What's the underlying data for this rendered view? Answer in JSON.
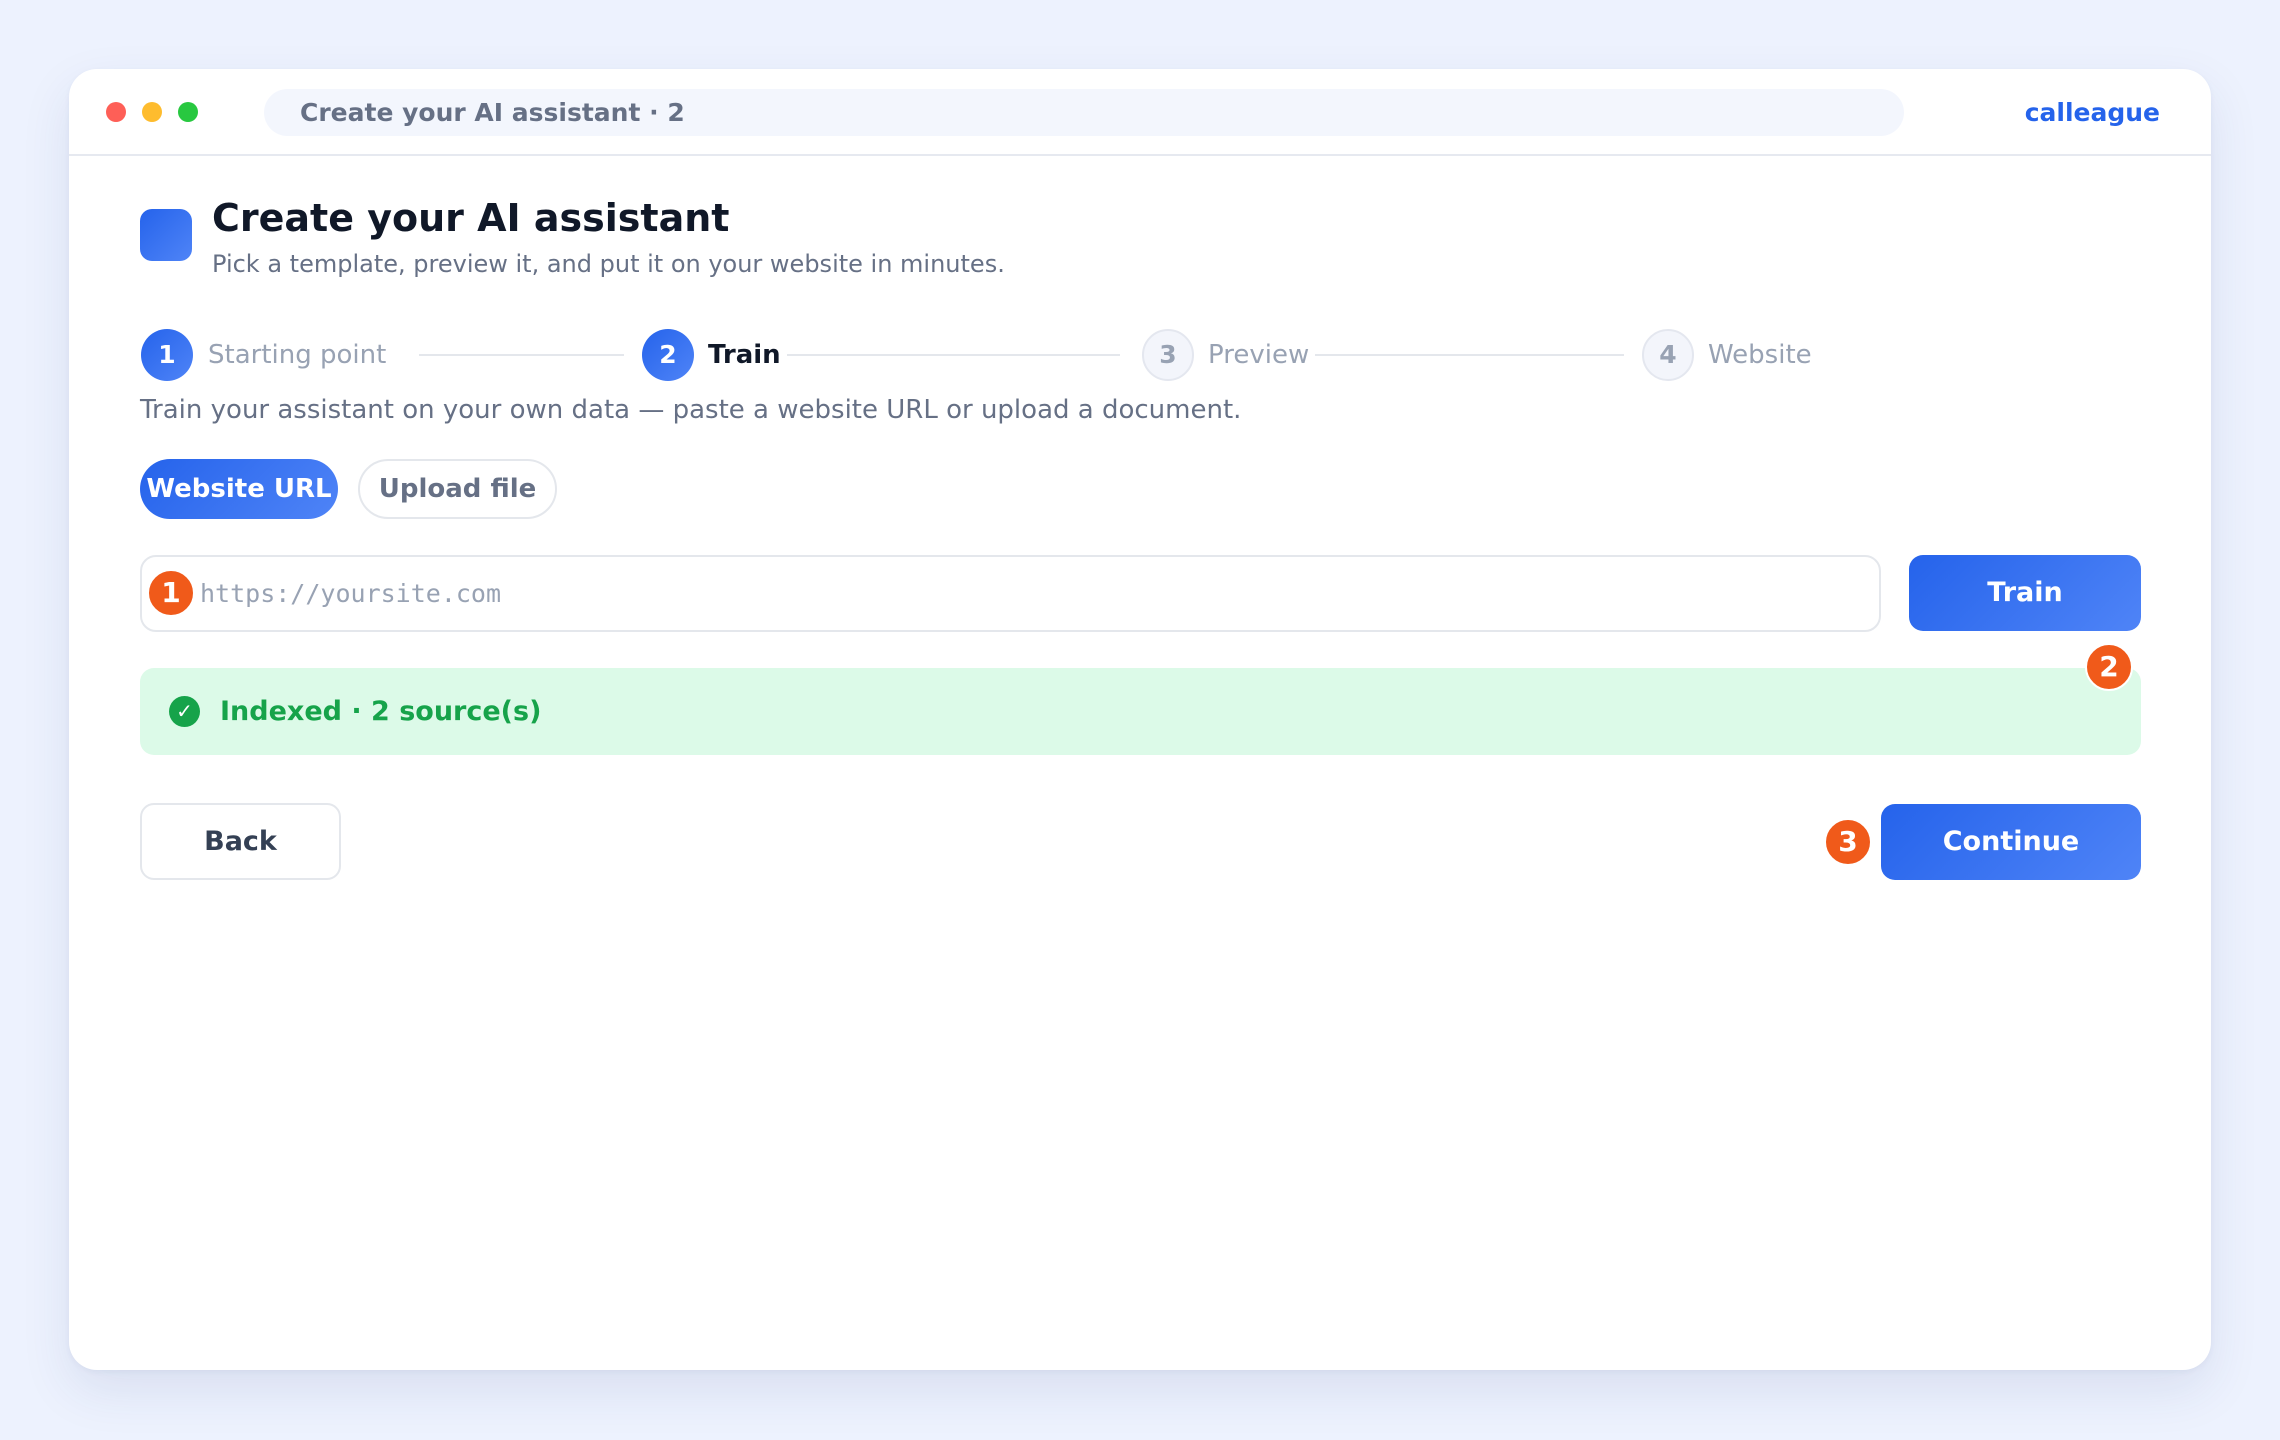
{
  "window": {
    "address": "Create your AI assistant · 2",
    "brand": "calleague"
  },
  "header": {
    "title": "Create your AI assistant",
    "subtitle": "Pick a template, preview it, and put it on your website in minutes."
  },
  "steps": [
    {
      "number": "1",
      "label": "Starting point",
      "state": "done"
    },
    {
      "number": "2",
      "label": "Train",
      "state": "active"
    },
    {
      "number": "3",
      "label": "Preview",
      "state": "todo"
    },
    {
      "number": "4",
      "label": "Website",
      "state": "todo"
    }
  ],
  "instruction": "Train your assistant on your own data — paste a website URL or upload a document.",
  "source_tabs": [
    {
      "label": "Website URL",
      "selected": true
    },
    {
      "label": "Upload file",
      "selected": false
    }
  ],
  "url_input": {
    "placeholder": "https://yoursite.com",
    "value": ""
  },
  "train_button": "Train",
  "status": {
    "icon": "check-circle-icon",
    "text": "Indexed · 2 source(s)"
  },
  "back_button": "Back",
  "continue_button": "Continue",
  "annotations": [
    "1",
    "2",
    "3"
  ],
  "colors": {
    "accent": "#2563eb",
    "annotation": "#f05a1a",
    "success": "#16a34a",
    "success_bg": "#dcfae8"
  }
}
